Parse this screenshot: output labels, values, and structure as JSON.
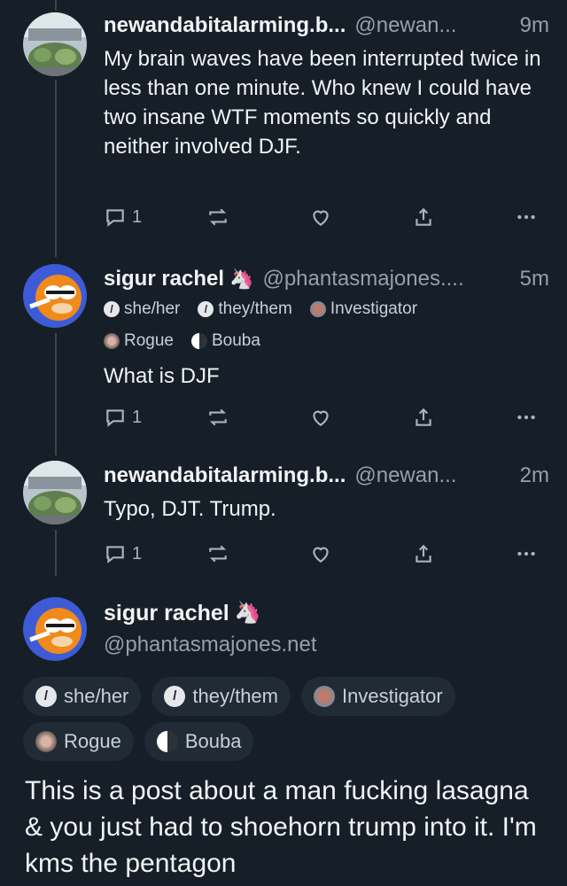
{
  "posts": [
    {
      "name": "newandabitalarming.b...",
      "handle": "@newan...",
      "time": "9m",
      "text": "My brain waves have been interrupted twice in less than one minute.  Who knew I could have two insane WTF moments so quickly and neither involved DJF.",
      "reply_count": "1"
    },
    {
      "name": "sigur rachel",
      "handle": "@phantasmajones....",
      "time": "5m",
      "badges": [
        "she/her",
        "they/them",
        "Investigator",
        "Rogue",
        "Bouba"
      ],
      "text": "What is DJF",
      "reply_count": "1"
    },
    {
      "name": "newandabitalarming.b...",
      "handle": "@newan...",
      "time": "2m",
      "text": "Typo, DJT.  Trump.",
      "reply_count": "1"
    }
  ],
  "main": {
    "name": "sigur rachel",
    "handle": "@phantasmajones.net",
    "badges": [
      "she/her",
      "they/them",
      "Investigator",
      "Rogue",
      "Bouba"
    ],
    "text": "This is a post about a man fucking lasagna & you just had to shoehorn trump into it. I'm kms the pentagon"
  },
  "icons": {
    "reply": "reply-icon",
    "repost": "repost-icon",
    "like": "heart-icon",
    "share": "share-icon",
    "more": "more-icon",
    "unicorn": "unicorn-emoji"
  },
  "colors": {
    "background": "#161e27",
    "muted": "#94a0ad",
    "pill": "#212b36"
  }
}
